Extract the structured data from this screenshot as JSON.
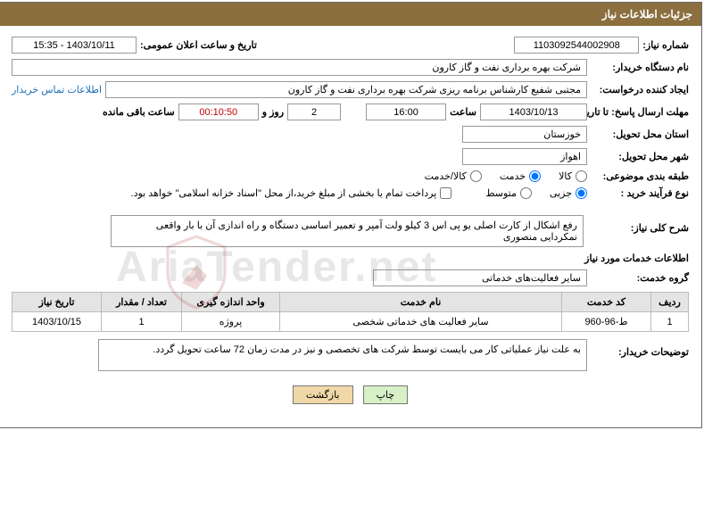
{
  "header": {
    "title": "جزئیات اطلاعات نیاز"
  },
  "fields": {
    "need_number_label": "شماره نیاز:",
    "need_number": "1103092544002908",
    "announce_datetime_label": "تاریخ و ساعت اعلان عمومی:",
    "announce_datetime": "1403/10/11 - 15:35",
    "buyer_org_label": "نام دستگاه خریدار:",
    "buyer_org": "شرکت بهره برداری نفت و گاز کارون",
    "requester_label": "ایجاد کننده درخواست:",
    "requester": "مجتبی شفیع کارشناس برنامه ریزی شرکت بهره برداری نفت و گاز کارون",
    "buyer_contact_link": "اطلاعات تماس خریدار",
    "deadline_label": "مهلت ارسال پاسخ: تا تاریخ:",
    "deadline_date": "1403/10/13",
    "time_label": "ساعت",
    "deadline_time": "16:00",
    "days_label": "روز و",
    "days": "2",
    "countdown": "00:10:50",
    "remaining_label": "ساعت باقی مانده",
    "province_label": "استان محل تحویل:",
    "province": "خوزستان",
    "city_label": "شهر محل تحویل:",
    "city": "اهواز",
    "subject_class_label": "طبقه بندی موضوعی:",
    "radio_kala": "کالا",
    "radio_khadmat": "خدمت",
    "radio_kala_khadmat": "کالا/خدمت",
    "purchase_type_label": "نوع فرآیند خرید :",
    "radio_jozi": "جزیی",
    "radio_motavaset": "متوسط",
    "payment_note": "پرداخت تمام یا بخشی از مبلغ خرید،از محل \"اسناد خزانه اسلامی\" خواهد بود.",
    "need_desc_label": "شرح کلی نیاز:",
    "need_desc": "رفع اشکال از کارت اصلی یو پی اس 3 کیلو ولت آمپر و تعمیر اساسی دستگاه و راه اندازی آن با بار واقعی\nنمکردایی منصوری",
    "service_info_label": "اطلاعات خدمات مورد نیاز",
    "service_group_label": "گروه خدمت:",
    "service_group": "سایر فعالیت‌های خدماتی",
    "buyer_note_label": "توضیحات خریدار:",
    "buyer_note": "به علت نیاز عملیاتی کار می بایست توسط شرکت های تخصصی و نیز در مدت زمان 72 ساعت تحویل گردد."
  },
  "table": {
    "headers": {
      "row": "ردیف",
      "service_code": "کد خدمت",
      "service_name": "نام خدمت",
      "unit": "واحد اندازه گیری",
      "qty": "تعداد / مقدار",
      "need_date": "تاریخ نیاز"
    },
    "rows": [
      {
        "row": "1",
        "service_code": "ط-96-960",
        "service_name": "سایر فعالیت های خدماتی شخصی",
        "unit": "پروژه",
        "qty": "1",
        "need_date": "1403/10/15"
      }
    ]
  },
  "buttons": {
    "print": "چاپ",
    "back": "بازگشت"
  },
  "watermark": "AriaTender.net"
}
